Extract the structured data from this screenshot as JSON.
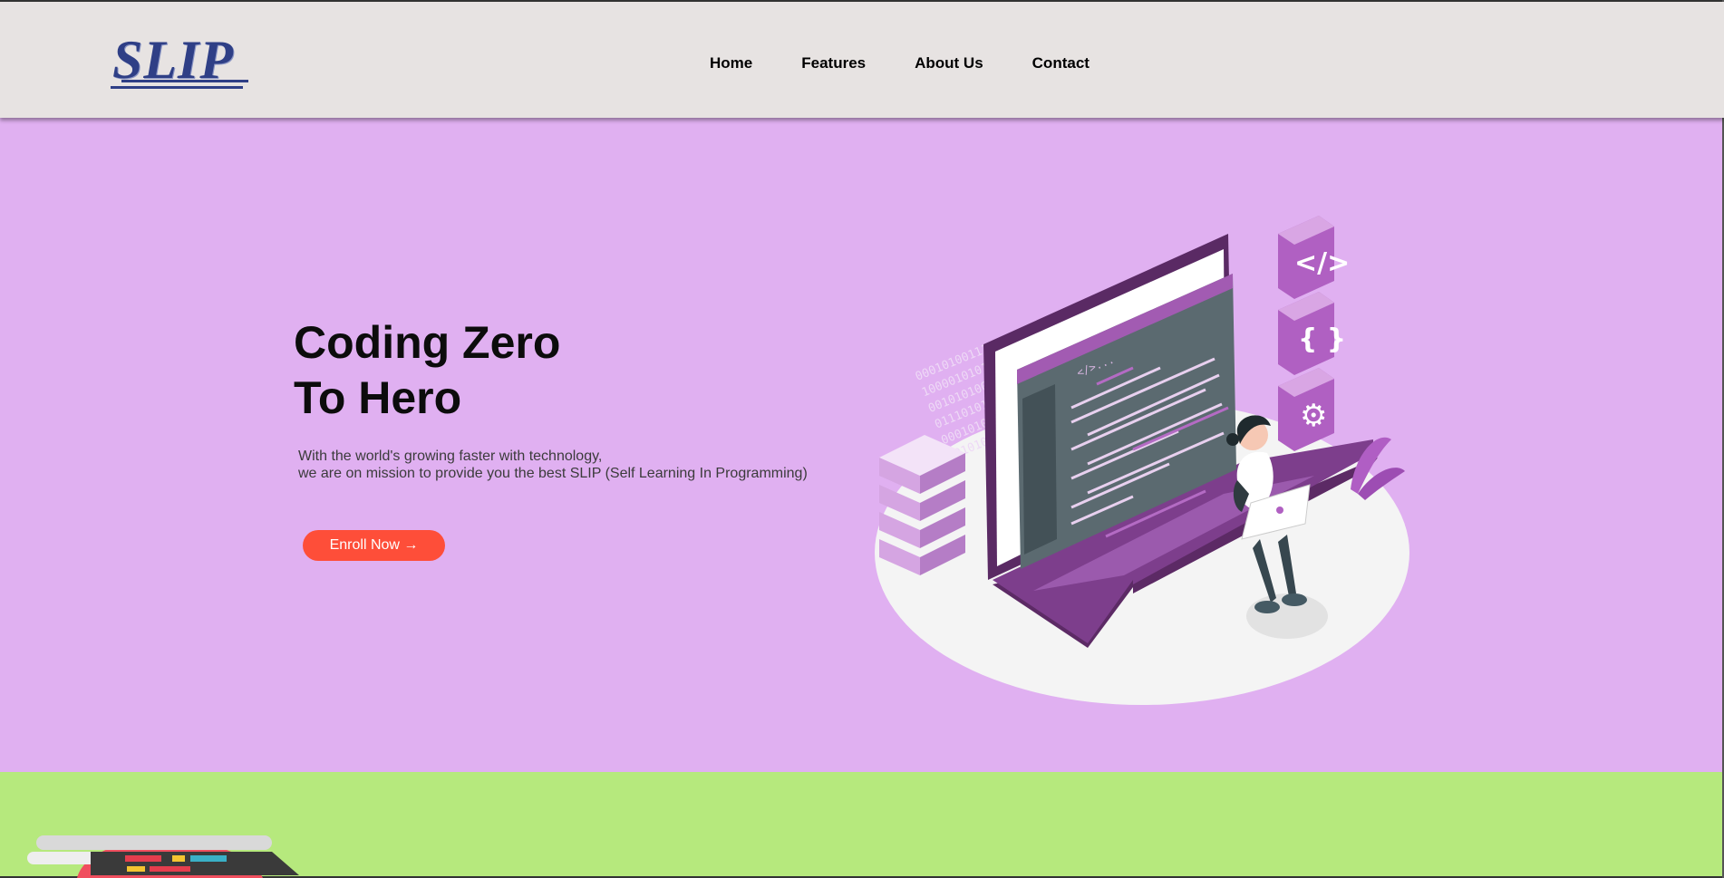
{
  "brand": {
    "logo_text": "SLIP",
    "color": "#2f3f86"
  },
  "nav": {
    "items": [
      {
        "label": "Home"
      },
      {
        "label": "Features"
      },
      {
        "label": "About Us"
      },
      {
        "label": "Contact"
      }
    ]
  },
  "hero": {
    "title_line1": "Coding Zero",
    "title_line2": "To Hero",
    "desc_line1": "With the world's growing faster with technology,",
    "desc_line2": "we are on mission to provide you the best SLIP (Self Learning In Programming)",
    "cta_label": "Enroll Now →",
    "binary_rows": [
      "00010100111010110101000101010",
      "1000010101110101000101010101",
      "0010101000101010100010101001",
      "0111010100100011101010110101",
      "0001010010100101010101010001",
      "1010100101010010101001010101"
    ],
    "code_tag": "</>..."
  },
  "colors": {
    "header_bg": "#e7e3e2",
    "hero_bg": "#e0b0f1",
    "cta_bg": "#fe4e39",
    "features_bg": "#b6e97d",
    "accent_purple": "#9b4aa8"
  }
}
